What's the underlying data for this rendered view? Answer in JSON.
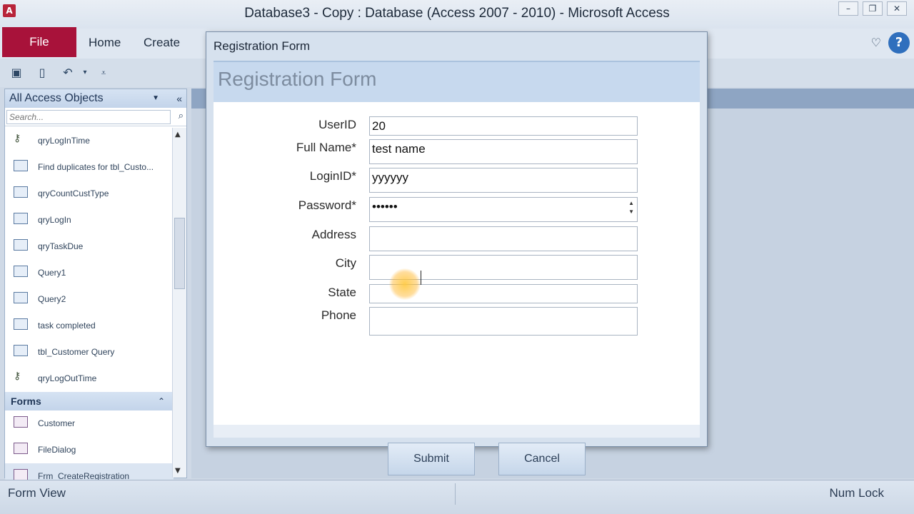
{
  "window": {
    "title": "Database3 - Copy : Database (Access 2007 - 2010) - Microsoft Access",
    "app_icon": "A"
  },
  "ribbon": {
    "file_label": "File",
    "tabs": [
      "Home",
      "Create"
    ]
  },
  "nav": {
    "header": "All Access Objects",
    "search_placeholder": "Search...",
    "queries": [
      {
        "label": "qryLogInTime",
        "icon": "key-icon"
      },
      {
        "label": "Find duplicates for tbl_Custo...",
        "icon": "query-icon"
      },
      {
        "label": "qryCountCustType",
        "icon": "query-icon"
      },
      {
        "label": "qryLogIn",
        "icon": "query-icon"
      },
      {
        "label": "qryTaskDue",
        "icon": "query-icon"
      },
      {
        "label": "Query1",
        "icon": "query-icon"
      },
      {
        "label": "Query2",
        "icon": "query-icon"
      },
      {
        "label": "task completed",
        "icon": "query-icon"
      },
      {
        "label": "tbl_Customer Query",
        "icon": "query-icon"
      },
      {
        "label": "qryLogOutTime",
        "icon": "key-icon"
      }
    ],
    "forms_header": "Forms",
    "forms": [
      {
        "label": "Customer"
      },
      {
        "label": "FileDialog"
      },
      {
        "label": "Frm_CreateRegistration"
      }
    ]
  },
  "dialog": {
    "title": "Registration Form",
    "form_title": "Registration Form",
    "fields": {
      "userid": {
        "label": "UserID",
        "value": "20"
      },
      "fullname": {
        "label": "Full Name*",
        "value": "test name"
      },
      "loginid": {
        "label": "LoginID*",
        "value": "yyyyyy"
      },
      "password": {
        "label": "Password*",
        "value": "••••••"
      },
      "address": {
        "label": "Address",
        "value": ""
      },
      "city": {
        "label": "City",
        "value": ""
      },
      "state": {
        "label": "State",
        "value": ""
      },
      "phone": {
        "label": "Phone",
        "value": ""
      }
    },
    "submit_label": "Submit",
    "cancel_label": "Cancel"
  },
  "status": {
    "left": "Form View",
    "right": "Num Lock"
  },
  "colors": {
    "file_tab": "#a8123a",
    "accent": "#2f6fbd"
  }
}
